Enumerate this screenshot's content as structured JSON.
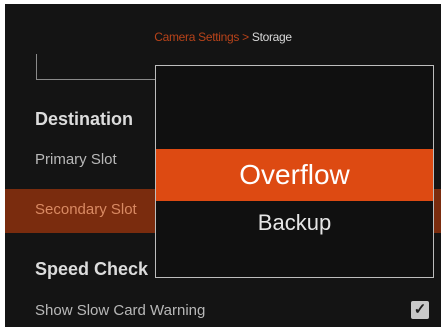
{
  "header": {
    "breadcrumb_path": "Camera Settings",
    "breadcrumb_separator": " > ",
    "breadcrumb_current": "Storage"
  },
  "sections": {
    "destination_heading": "Destination",
    "speed_check_heading": "Speed Check"
  },
  "rows": {
    "primary_slot_label": "Primary Slot",
    "secondary_slot_label": "Secondary Slot",
    "slow_card_warning_label": "Show Slow Card Warning",
    "slow_card_warning_checked": true
  },
  "popup": {
    "options": [
      "Overflow",
      "Backup"
    ],
    "selected": "Overflow"
  },
  "colors": {
    "accent": "#dd4a12",
    "selected_row": "#7a2c0e",
    "background": "#141414"
  },
  "icons": {
    "checkbox": "check-icon"
  }
}
